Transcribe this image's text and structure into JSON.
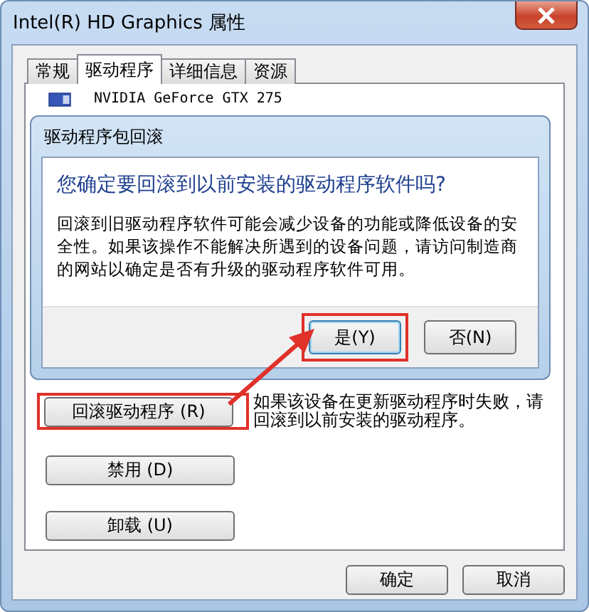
{
  "window": {
    "title": "Intel(R) HD Graphics 属性"
  },
  "tabs": [
    {
      "label": "常规",
      "selected": false
    },
    {
      "label": "驱动程序",
      "selected": true
    },
    {
      "label": "详细信息",
      "selected": false
    },
    {
      "label": "资源",
      "selected": false
    }
  ],
  "device_name": "NVIDIA GeForce GTX 275",
  "dialog": {
    "title": "驱动程序包回滚",
    "heading": "您确定要回滚到以前安装的驱动程序软件吗?",
    "message": "回滚到旧驱动程序软件可能会减少设备的功能或降低设备的安全性。如果该操作不能解决所遇到的设备问题，请访问制造商的网站以确定是否有升级的驱动程序软件可用。",
    "buttons": [
      {
        "label": "是(Y)",
        "highlighted": true
      },
      {
        "label": "否(N)",
        "highlighted": false
      }
    ]
  },
  "actions": [
    {
      "label": "回滚驱动程序 (R)",
      "highlighted": true,
      "description": "如果该设备在更新驱动程序时失败，请回滚到以前安装的驱动程序。"
    },
    {
      "label": "禁用 (D)",
      "highlighted": false
    },
    {
      "label": "卸载 (U)",
      "highlighted": false
    }
  ],
  "footer_buttons": [
    "确定",
    "取消"
  ]
}
